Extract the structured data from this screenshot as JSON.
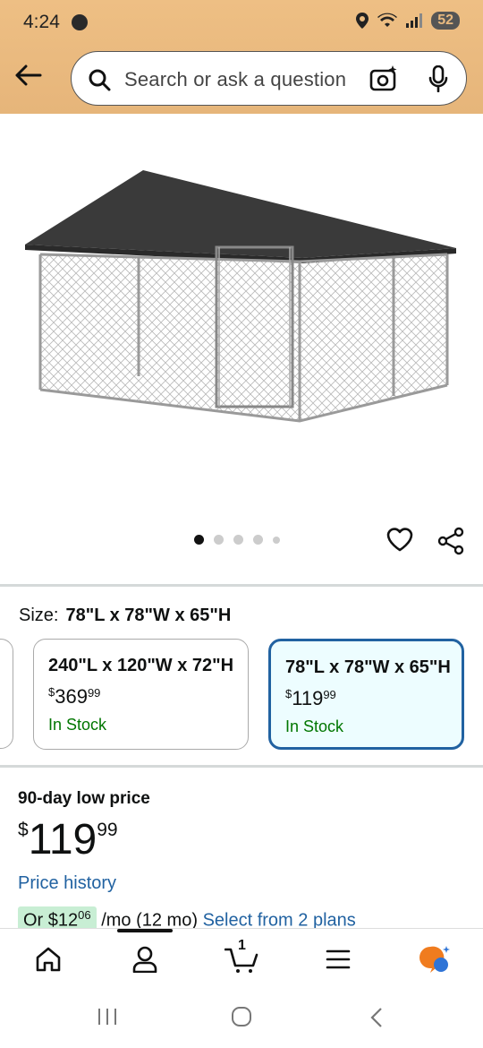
{
  "status": {
    "time": "4:24",
    "battery": "52"
  },
  "search": {
    "placeholder": "Search or ask a question"
  },
  "gallery": {
    "image_count": 5,
    "active_index": 0
  },
  "size": {
    "label": "Size:",
    "selected": "78\"L x 78\"W x 65\"H"
  },
  "variants": [
    {
      "title": "240\"L x 120\"W x 72\"H",
      "price_symbol": "$",
      "price_whole": "369",
      "price_cents": "99",
      "stock": "In Stock"
    },
    {
      "title": "78\"L x 78\"W x 65\"H",
      "price_symbol": "$",
      "price_whole": "119",
      "price_cents": "99",
      "stock": "In Stock"
    }
  ],
  "pricing": {
    "low_label": "90-day low price",
    "symbol": "$",
    "whole": "119",
    "cents": "99",
    "history_link": "Price history",
    "plans_prefix": "Or $12",
    "plans_cents": "06",
    "plans_suffix": "/mo (12 mo)",
    "plans_link": "Select from 2 plans"
  },
  "nav": {
    "cart_count": "1"
  },
  "colors": {
    "header": "#e8b97f",
    "link": "#2162a1",
    "in_stock": "#007600",
    "selected_border": "#2162a1"
  }
}
